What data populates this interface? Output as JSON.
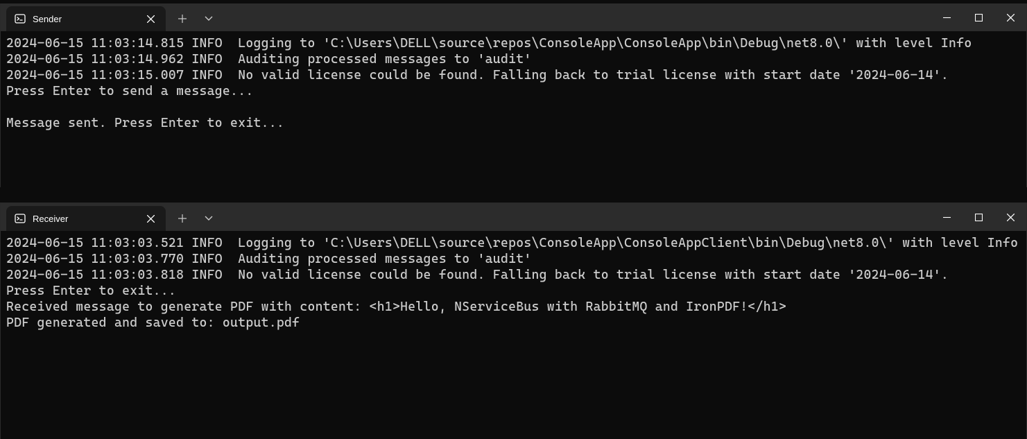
{
  "windows": [
    {
      "tab_title": "Sender",
      "lines": [
        "2024-06-15 11:03:14.815 INFO  Logging to 'C:\\Users\\DELL\\source\\repos\\ConsoleApp\\ConsoleApp\\bin\\Debug\\net8.0\\' with level Info",
        "2024-06-15 11:03:14.962 INFO  Auditing processed messages to 'audit'",
        "2024-06-15 11:03:15.007 INFO  No valid license could be found. Falling back to trial license with start date '2024-06-14'.",
        "Press Enter to send a message...",
        "",
        "Message sent. Press Enter to exit..."
      ]
    },
    {
      "tab_title": "Receiver",
      "lines": [
        "2024-06-15 11:03:03.521 INFO  Logging to 'C:\\Users\\DELL\\source\\repos\\ConsoleApp\\ConsoleAppClient\\bin\\Debug\\net8.0\\' with level Info",
        "2024-06-15 11:03:03.770 INFO  Auditing processed messages to 'audit'",
        "2024-06-15 11:03:03.818 INFO  No valid license could be found. Falling back to trial license with start date '2024-06-14'.",
        "Press Enter to exit...",
        "Received message to generate PDF with content: <h1>Hello, NServiceBus with RabbitMQ and IronPDF!</h1>",
        "PDF generated and saved to: output.pdf"
      ]
    }
  ]
}
